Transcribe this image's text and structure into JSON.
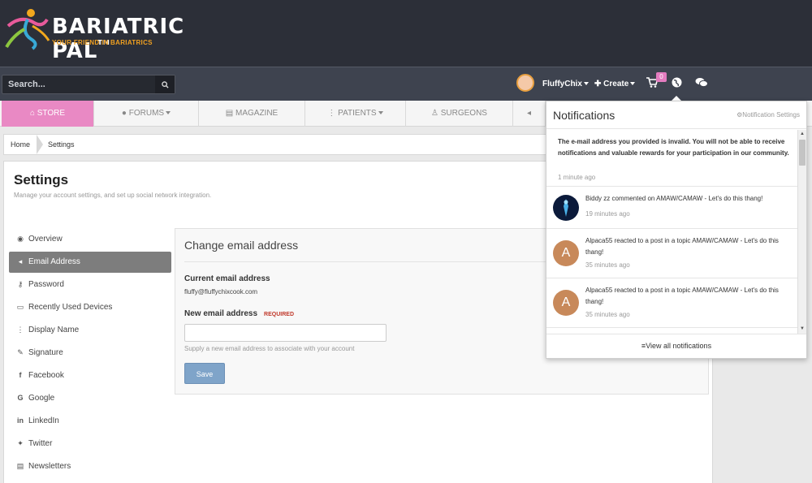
{
  "brand": {
    "title": "BARIATRIC PAL",
    "tm": "TM",
    "tagline": "YOUR FRIEND IN BARIATRICS"
  },
  "userbar": {
    "search_placeholder": "Search...",
    "username": "FluffyChix",
    "create_label": "Create",
    "cart_count": "0"
  },
  "nav": {
    "items": [
      {
        "label": "STORE"
      },
      {
        "label": "FORUMS"
      },
      {
        "label": "MAGAZINE"
      },
      {
        "label": "PATIENTS"
      },
      {
        "label": "SURGEONS"
      }
    ]
  },
  "breadcrumb": {
    "home": "Home",
    "current": "Settings"
  },
  "page": {
    "title": "Settings",
    "subtitle": "Manage your account settings, and set up social network integration."
  },
  "sidebar": {
    "items": [
      {
        "label": "Overview"
      },
      {
        "label": "Email Address"
      },
      {
        "label": "Password"
      },
      {
        "label": "Recently Used Devices"
      },
      {
        "label": "Display Name"
      },
      {
        "label": "Signature"
      },
      {
        "label": "Facebook"
      },
      {
        "label": "Google"
      },
      {
        "label": "LinkedIn"
      },
      {
        "label": "Twitter"
      },
      {
        "label": "Newsletters"
      }
    ]
  },
  "form": {
    "title": "Change email address",
    "current_label": "Current email address",
    "current_value": "fluffy@fluffychixcook.com",
    "new_label": "New email address",
    "required": "REQUIRED",
    "hint": "Supply a new email address to associate with your account",
    "save_label": "Save"
  },
  "notifications": {
    "title": "Notifications",
    "settings_label": "Notification Settings",
    "items": [
      {
        "text": "The e-mail address you provided is invalid. You will not be able to receive notifications and valuable rewards for your participation in our community.",
        "time": "1 minute ago"
      },
      {
        "text": "Biddy zz commented on AMAW/CAMAW - Let's do this thang!",
        "time": "19 minutes ago"
      },
      {
        "text": "Alpaca55 reacted to a post in a topic AMAW/CAMAW - Let's do this thang!",
        "time": "35 minutes ago",
        "avatar": "A"
      },
      {
        "text": "Alpaca55 reacted to a post in a topic AMAW/CAMAW - Let's do this thang!",
        "time": "35 minutes ago",
        "avatar": "A"
      }
    ],
    "view_all": "View all notifications"
  },
  "colors": {
    "header": "#2c2f38",
    "store": "#e989c4",
    "save": "#7fa4c9",
    "avatar": "#c8895a"
  }
}
